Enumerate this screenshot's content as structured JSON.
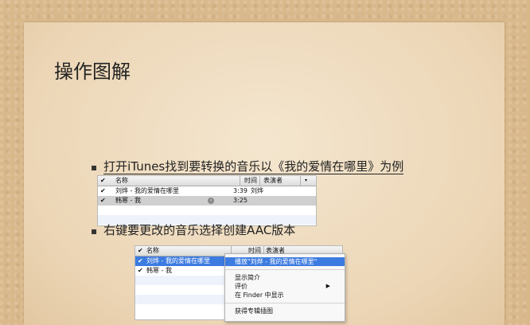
{
  "slide": {
    "title": "操作图解",
    "bullet1": "打开iTunes找到要转换的音乐以《我的爱情在哪里》为例",
    "bullet2": "右键要更改的音乐选择创建AAC版本"
  },
  "table1": {
    "headers": {
      "name": "名称",
      "time": "时间",
      "artist": "表演者"
    },
    "rows": [
      {
        "name": "刘烨 - 我的爱情在哪里",
        "time": "3:39",
        "artist": "刘烨"
      },
      {
        "name": "韩寒 - 我",
        "time": "3:25",
        "artist": ""
      }
    ]
  },
  "table2": {
    "headers": {
      "name": "名称",
      "time": "时间",
      "artist": "表演者"
    },
    "rows": [
      {
        "name": "刘烨 - 我的爱情在哪里"
      },
      {
        "name": "韩寒 - 我"
      }
    ]
  },
  "context_menu": {
    "items": [
      "播放\"刘烨 - 我的爱情在哪里\"",
      "显示简介",
      "评价",
      "在 Finder 中显示",
      "获得专辑插图"
    ],
    "submenu_arrow": "▶"
  },
  "glyphs": {
    "check": "✔",
    "bullet": "▪",
    "circle": "›"
  },
  "colors": {
    "selection": "#3c7be0",
    "paper": "#efdcbf",
    "background": "#d9b98c"
  }
}
